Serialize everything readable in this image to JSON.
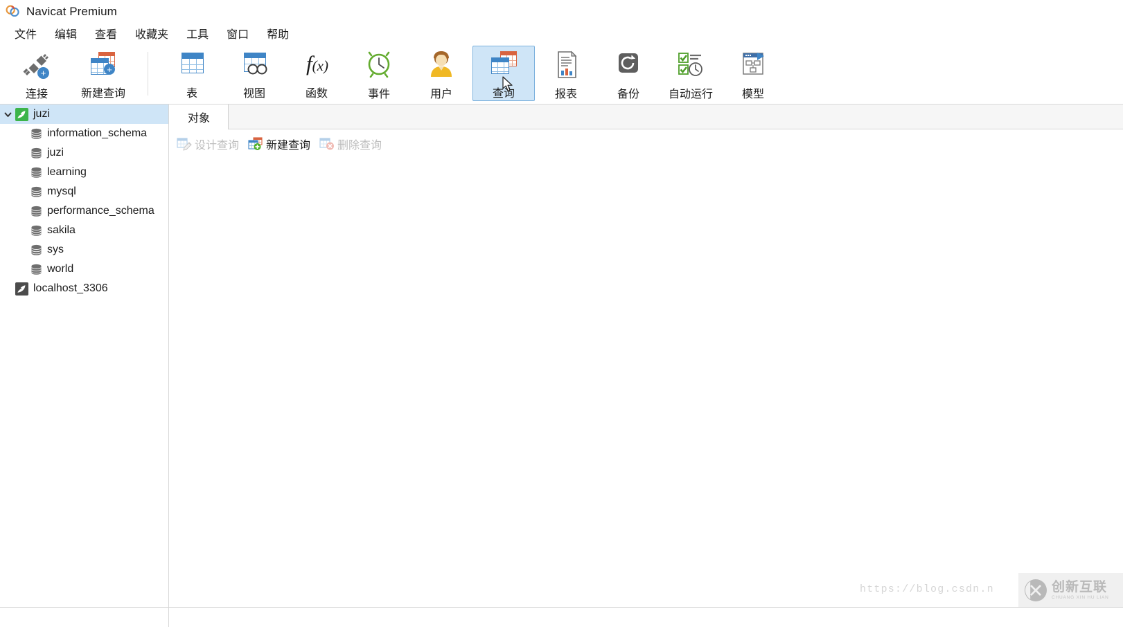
{
  "window": {
    "title": "Navicat Premium",
    "logo_icon": "navicat-logo-icon"
  },
  "menubar": {
    "items": [
      {
        "label": "文件",
        "name": "menu-file"
      },
      {
        "label": "编辑",
        "name": "menu-edit"
      },
      {
        "label": "查看",
        "name": "menu-view"
      },
      {
        "label": "收藏夹",
        "name": "menu-favorites"
      },
      {
        "label": "工具",
        "name": "menu-tools"
      },
      {
        "label": "窗口",
        "name": "menu-window"
      },
      {
        "label": "帮助",
        "name": "menu-help"
      }
    ]
  },
  "toolbar": {
    "buttons": [
      {
        "label": "连接",
        "icon": "connection-plug-icon",
        "selected": false,
        "has_dropdown": true
      },
      {
        "label": "新建查询",
        "icon": "new-query-icon",
        "selected": false,
        "has_dropdown": false
      },
      {
        "label": "表",
        "icon": "table-icon",
        "selected": false,
        "has_dropdown": false
      },
      {
        "label": "视图",
        "icon": "view-icon",
        "selected": false,
        "has_dropdown": false
      },
      {
        "label": "函数",
        "icon": "function-fx-icon",
        "selected": false,
        "has_dropdown": false
      },
      {
        "label": "事件",
        "icon": "event-clock-icon",
        "selected": false,
        "has_dropdown": false
      },
      {
        "label": "用户",
        "icon": "user-icon",
        "selected": false,
        "has_dropdown": false
      },
      {
        "label": "查询",
        "icon": "query-icon",
        "selected": true,
        "has_dropdown": false
      },
      {
        "label": "报表",
        "icon": "report-icon",
        "selected": false,
        "has_dropdown": false
      },
      {
        "label": "备份",
        "icon": "backup-icon",
        "selected": false,
        "has_dropdown": false
      },
      {
        "label": "自动运行",
        "icon": "automation-icon",
        "selected": false,
        "has_dropdown": false
      },
      {
        "label": "模型",
        "icon": "model-icon",
        "selected": false,
        "has_dropdown": false
      }
    ]
  },
  "sidebar": {
    "tree": [
      {
        "label": "juzi",
        "type": "connection",
        "icon": "mysql-connected-icon",
        "selected": true,
        "expanded": true,
        "indent": 0
      },
      {
        "label": "information_schema",
        "type": "database",
        "icon": "database-icon",
        "selected": false,
        "indent": 1
      },
      {
        "label": "juzi",
        "type": "database",
        "icon": "database-icon",
        "selected": false,
        "indent": 1
      },
      {
        "label": "learning",
        "type": "database",
        "icon": "database-icon",
        "selected": false,
        "indent": 1
      },
      {
        "label": "mysql",
        "type": "database",
        "icon": "database-icon",
        "selected": false,
        "indent": 1
      },
      {
        "label": "performance_schema",
        "type": "database",
        "icon": "database-icon",
        "selected": false,
        "indent": 1
      },
      {
        "label": "sakila",
        "type": "database",
        "icon": "database-icon",
        "selected": false,
        "indent": 1
      },
      {
        "label": "sys",
        "type": "database",
        "icon": "database-icon",
        "selected": false,
        "indent": 1
      },
      {
        "label": "world",
        "type": "database",
        "icon": "database-icon",
        "selected": false,
        "indent": 1
      },
      {
        "label": "localhost_3306",
        "type": "connection",
        "icon": "mysql-disconnected-icon",
        "selected": false,
        "expanded": false,
        "indent": 0
      }
    ]
  },
  "main": {
    "tabs": [
      {
        "label": "对象",
        "active": true
      }
    ],
    "actions": [
      {
        "label": "设计查询",
        "icon": "design-query-icon",
        "enabled": false
      },
      {
        "label": "新建查询",
        "icon": "new-query-plus-icon",
        "enabled": true
      },
      {
        "label": "删除查询",
        "icon": "delete-query-icon",
        "enabled": false
      }
    ],
    "content": ""
  },
  "watermark": {
    "url": "https://blog.csdn.n",
    "brand": "创新互联",
    "brand_sub": "CHUANG XIN HU LIAN",
    "logo_icon": "cx-circle-logo-icon"
  },
  "colors": {
    "selection": "#cfe5f7",
    "selection_border": "#7ab0dd",
    "accent_blue": "#3f85c6",
    "accent_red": "#d9633f",
    "accent_green": "#58a618",
    "text": "#1b1b1b",
    "disabled_text": "#bdbdbd",
    "border": "#d7d7d7"
  }
}
